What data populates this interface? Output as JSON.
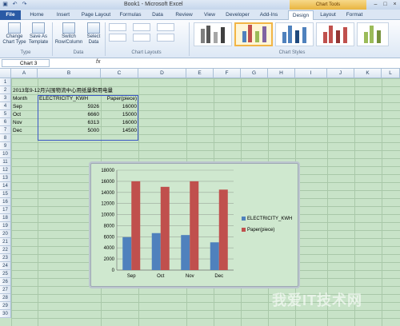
{
  "window": {
    "title": "Book1 - Microsoft Excel",
    "chart_tools_label": "Chart Tools"
  },
  "tabs": [
    "File",
    "Home",
    "Insert",
    "Page Layout",
    "Formulas",
    "Data",
    "Review",
    "View",
    "Developer",
    "Add-Ins",
    "Design",
    "Layout",
    "Format"
  ],
  "ribbon": {
    "change_chart_type": "Change Chart Type",
    "save_as_template": "Save As Template",
    "switch_row_column": "Switch Row/Column",
    "select_data": "Select Data",
    "group_type": "Type",
    "group_data": "Data",
    "group_chart_layouts": "Chart Layouts",
    "group_chart_styles": "Chart Styles"
  },
  "formula_bar": {
    "name_box": "Chart 3",
    "fx": "fx",
    "value": ""
  },
  "columns": [
    "A",
    "B",
    "C",
    "D",
    "E",
    "F",
    "G",
    "H",
    "I",
    "J",
    "K",
    "L"
  ],
  "rows": [
    "1",
    "2",
    "3",
    "4",
    "5",
    "6",
    "7",
    "8",
    "9",
    "10",
    "11",
    "12",
    "13",
    "14",
    "15",
    "16",
    "17",
    "18",
    "19",
    "20",
    "21",
    "22",
    "23",
    "24",
    "25",
    "26",
    "27",
    "28",
    "29",
    "30"
  ],
  "sheet": {
    "title": "2013年9-12月兴围物流中心用纸量和用电量",
    "headers": [
      "Month",
      "ELECTRICITY_KWH",
      "Paper(piece)"
    ],
    "data": [
      [
        "Sep",
        "5926",
        "16000"
      ],
      [
        "Oct",
        "6660",
        "15000"
      ],
      [
        "Nov",
        "6313",
        "16000"
      ],
      [
        "Dec",
        "5000",
        "14500"
      ]
    ]
  },
  "colors": {
    "electricity": "#4f81bd",
    "paper": "#c0504d",
    "chart_bg": "#cfe8cf"
  },
  "chart_data": {
    "type": "bar",
    "categories": [
      "Sep",
      "Oct",
      "Nov",
      "Dec"
    ],
    "series": [
      {
        "name": "ELECTRICITY_KWH",
        "values": [
          5926,
          6660,
          6313,
          5000
        ]
      },
      {
        "name": "Paper(piece)",
        "values": [
          16000,
          15000,
          16000,
          14500
        ]
      }
    ],
    "ylim": [
      0,
      18000
    ],
    "yticks": [
      "0",
      "2000",
      "4000",
      "6000",
      "8000",
      "10000",
      "12000",
      "14000",
      "16000",
      "18000"
    ],
    "legend": "right",
    "grid": true
  },
  "watermark": "我爱IT技术网"
}
